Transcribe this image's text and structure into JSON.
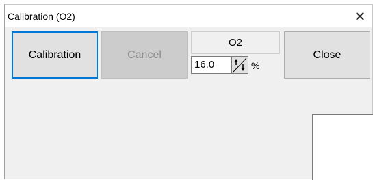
{
  "window": {
    "title": "Calibration (O2)",
    "close_glyph": "✕"
  },
  "buttons": {
    "calibration_label": "Calibration",
    "cancel_label": "Cancel",
    "close_label": "Close"
  },
  "gas": {
    "name": "O2",
    "value": "16.0",
    "unit": "%"
  },
  "icons": {
    "spin": "up-down-spin-icon",
    "close": "close-icon"
  },
  "colors": {
    "focus_border": "#0078d7",
    "disabled_button_bg": "#cccccc",
    "disabled_text": "#8c8c8c",
    "client_bg": "#f0f0f0"
  }
}
